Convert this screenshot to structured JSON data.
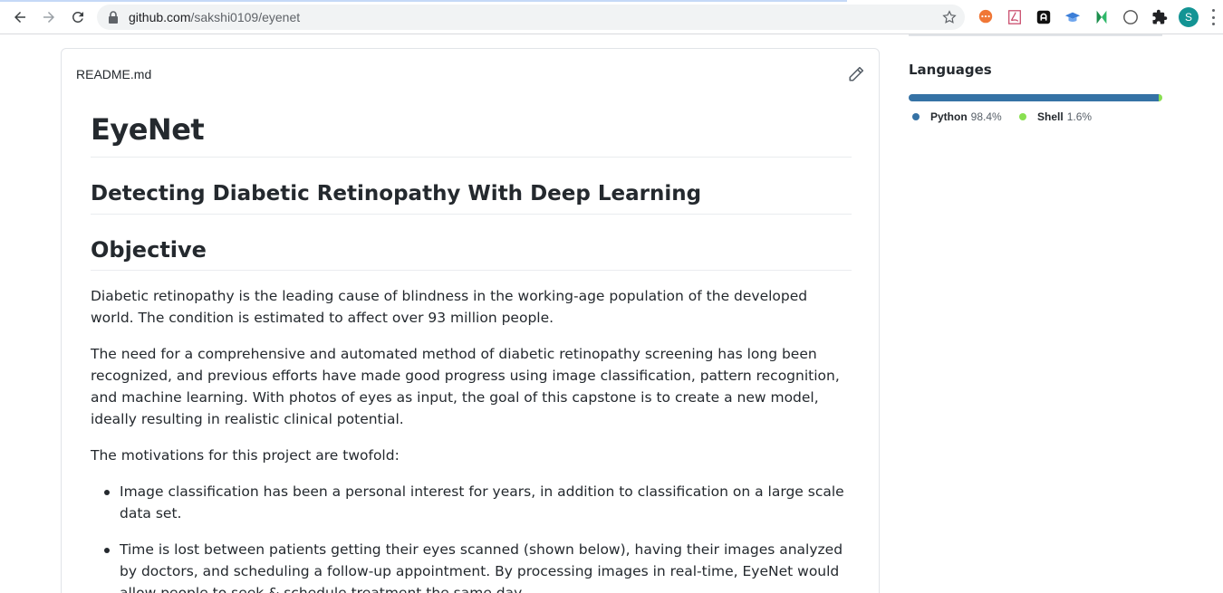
{
  "browser": {
    "url_domain": "github.com",
    "url_path": "/sakshi0109/eyenet",
    "profile_initial": "S",
    "extensions": [
      "chat-bubble-icon",
      "pdf-icon",
      "translate-icon",
      "graduation-cap-icon",
      "kite-icon",
      "dark-mode-icon",
      "puzzle-icon"
    ]
  },
  "readme": {
    "filename": "README.md",
    "title": "EyeNet",
    "subtitle": "Detecting Diabetic Retinopathy With Deep Learning",
    "section_heading": "Objective",
    "paragraphs": [
      "Diabetic retinopathy is the leading cause of blindness in the working-age population of the developed world. The condition is estimated to affect over 93 million people.",
      "The need for a comprehensive and automated method of diabetic retinopathy screening has long been recognized, and previous efforts have made good progress using image classification, pattern recognition, and machine learning. With photos of eyes as input, the goal of this capstone is to create a new model, ideally resulting in realistic clinical potential.",
      "The motivations for this project are twofold:"
    ],
    "bullets": [
      "Image classification has been a personal interest for years, in addition to classification on a large scale data set.",
      "Time is lost between patients getting their eyes scanned (shown below), having their images analyzed by doctors, and scheduling a follow-up appointment. By processing images in real-time, EyeNet would allow people to seek & schedule treatment the same day."
    ]
  },
  "languages": {
    "title": "Languages",
    "items": [
      {
        "name": "Python",
        "percent_label": "98.4%",
        "percent": 98.4,
        "color": "#3572A5"
      },
      {
        "name": "Shell",
        "percent_label": "1.6%",
        "percent": 1.6,
        "color": "#89e051"
      }
    ]
  }
}
